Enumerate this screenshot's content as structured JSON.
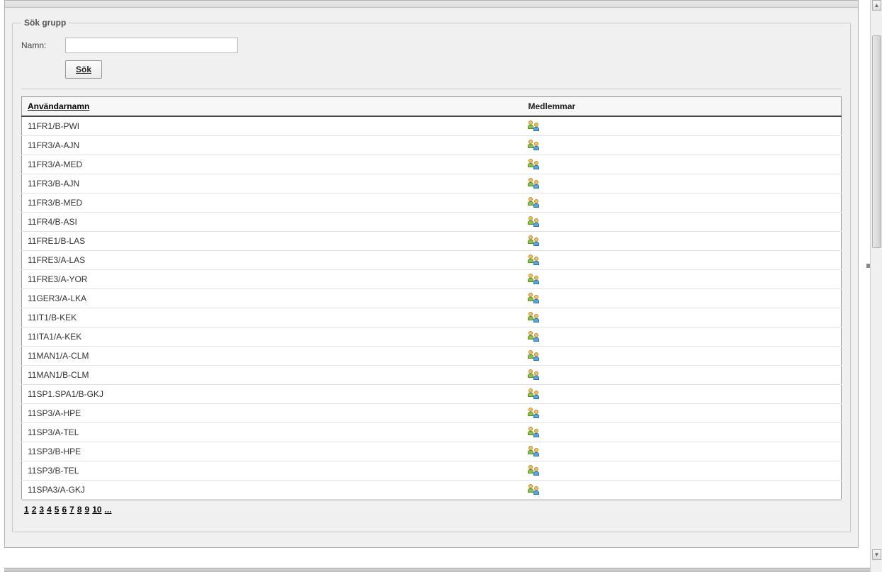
{
  "search": {
    "legend": "Sök grupp",
    "name_label": "Namn:",
    "name_value": "",
    "submit_label": "Sök"
  },
  "table": {
    "headers": {
      "username": "Användarnamn",
      "members": "Medlemmar"
    },
    "rows": [
      {
        "username": "11FR1/B-PWI"
      },
      {
        "username": "11FR3/A-AJN"
      },
      {
        "username": "11FR3/A-MED"
      },
      {
        "username": "11FR3/B-AJN"
      },
      {
        "username": "11FR3/B-MED"
      },
      {
        "username": "11FR4/B-ASI"
      },
      {
        "username": "11FRE1/B-LAS"
      },
      {
        "username": "11FRE3/A-LAS"
      },
      {
        "username": "11FRE3/A-YOR"
      },
      {
        "username": "11GER3/A-LKA"
      },
      {
        "username": "11IT1/B-KEK"
      },
      {
        "username": "11ITA1/A-KEK"
      },
      {
        "username": "11MAN1/A-CLM"
      },
      {
        "username": "11MAN1/B-CLM"
      },
      {
        "username": "11SP1.SPA1/B-GKJ"
      },
      {
        "username": "11SP3/A-HPE"
      },
      {
        "username": "11SP3/A-TEL"
      },
      {
        "username": "11SP3/B-HPE"
      },
      {
        "username": "11SP3/B-TEL"
      },
      {
        "username": "11SPA3/A-GKJ"
      }
    ]
  },
  "pager": {
    "pages": [
      "1",
      "2",
      "3",
      "4",
      "5",
      "6",
      "7",
      "8",
      "9",
      "10",
      "..."
    ],
    "current": "1"
  }
}
